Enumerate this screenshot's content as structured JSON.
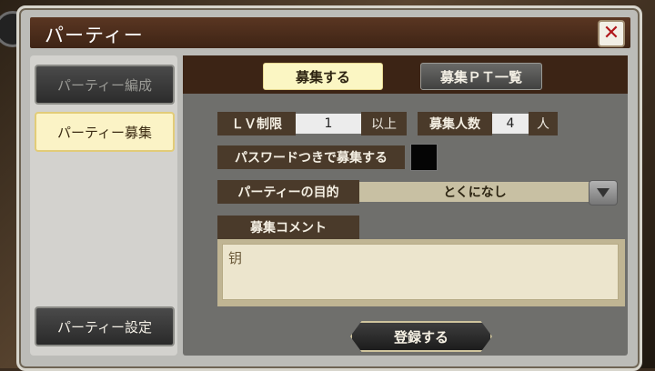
{
  "window": {
    "title": "パーティー"
  },
  "sidebar": {
    "items": [
      {
        "label": "パーティー編成"
      },
      {
        "label": "パーティー募集"
      }
    ],
    "settings_label": "パーティー設定"
  },
  "tabs": [
    {
      "label": "募集する"
    },
    {
      "label": "募集ＰＴ一覧"
    }
  ],
  "form": {
    "level_limit": {
      "label": "ＬＶ制限",
      "value": "1",
      "unit": "以上"
    },
    "recruit_count": {
      "label": "募集人数",
      "value": "4",
      "unit": "人"
    },
    "password_label": "パスワードつきで募集する",
    "purpose": {
      "label": "パーティーの目的",
      "value": "とくになし"
    },
    "comment": {
      "label": "募集コメント",
      "value": "钥"
    },
    "register_label": "登録する"
  }
}
